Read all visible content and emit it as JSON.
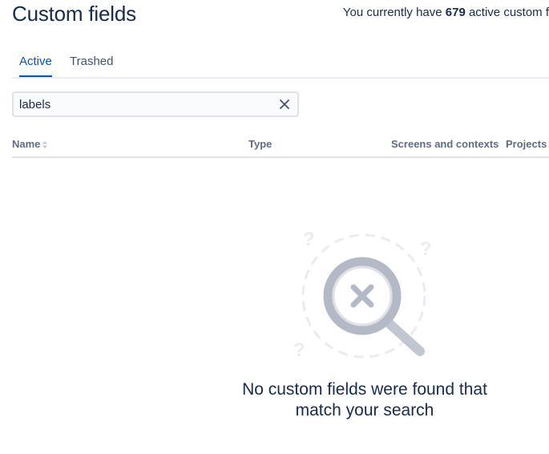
{
  "header": {
    "title": "Custom fields",
    "count_prefix": "You currently have ",
    "count_value": "679",
    "count_suffix": " active custom f"
  },
  "tabs": [
    {
      "label": "Active",
      "active": true
    },
    {
      "label": "Trashed",
      "active": false
    }
  ],
  "search": {
    "value": "labels",
    "placeholder": ""
  },
  "table": {
    "columns": [
      "Name",
      "Type",
      "Screens and contexts",
      "Projects"
    ]
  },
  "empty_state": {
    "message_line1": "No custom fields were found that",
    "message_line2": "match your search"
  },
  "colors": {
    "accent": "#0052cc",
    "text": "#172b4d",
    "muted": "#5e6c84",
    "border": "#dfe1e6"
  }
}
